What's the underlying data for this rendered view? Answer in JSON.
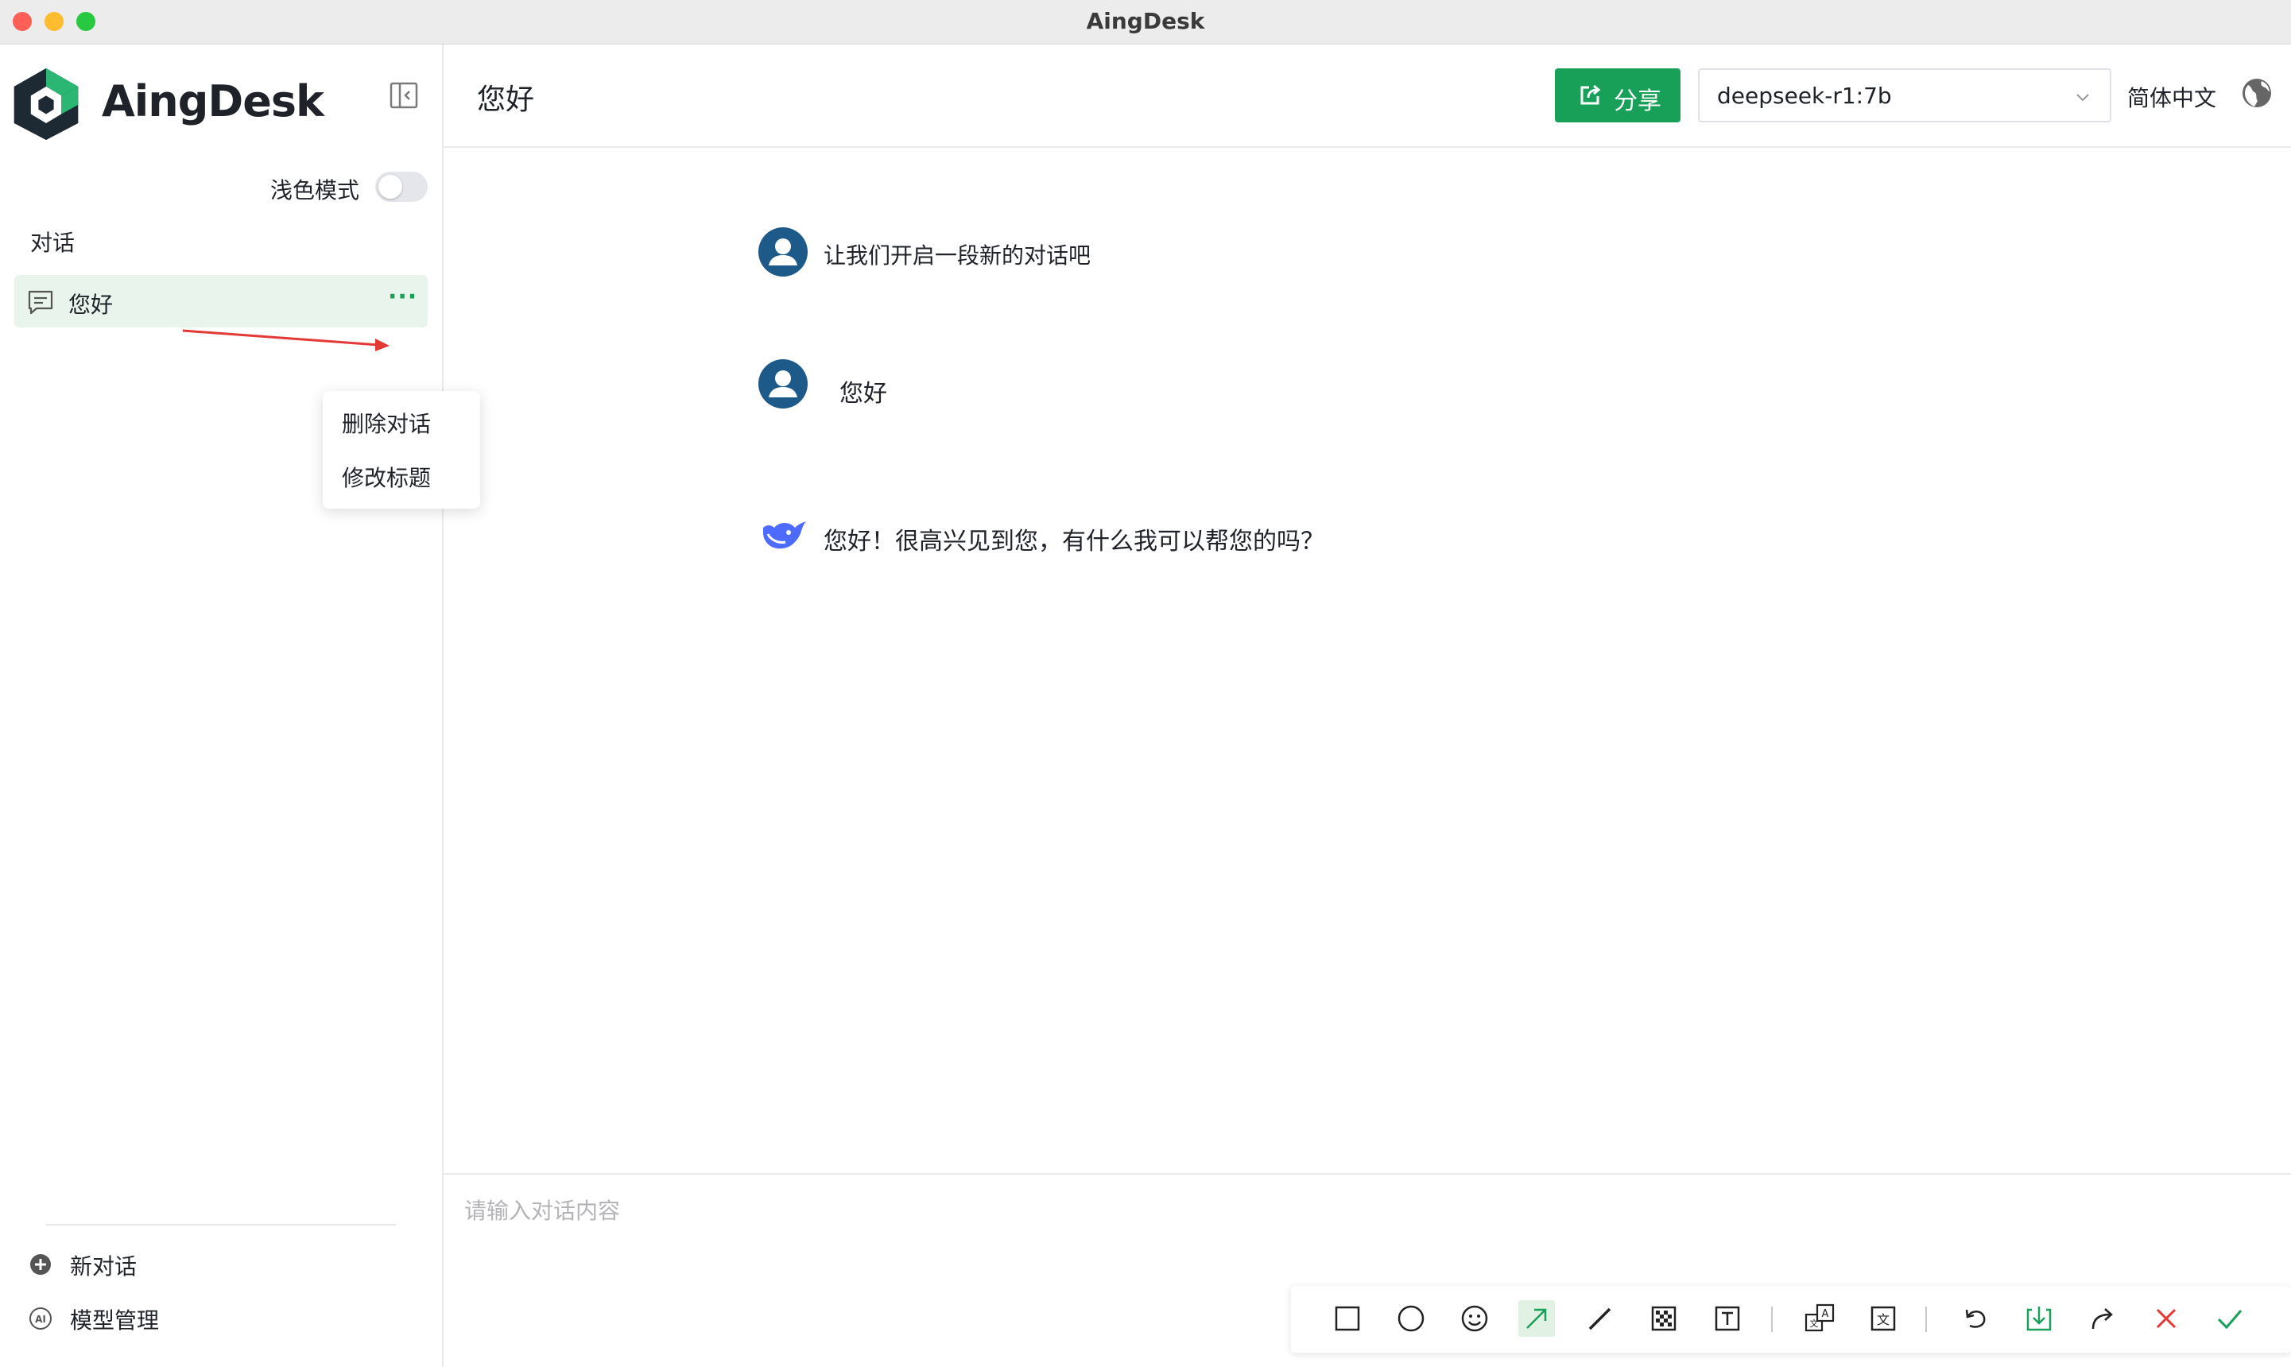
{
  "window": {
    "title": "AingDesk"
  },
  "sidebar": {
    "logo_text": "AingDesk",
    "theme_label": "浅色模式",
    "theme_toggle_on": false,
    "section_label": "对话",
    "conversations": [
      {
        "title": "您好",
        "more": "···",
        "active": true
      }
    ],
    "context_menu": {
      "items": [
        "删除对话",
        "修改标题"
      ]
    },
    "bottom": {
      "new_conversation": "新对话",
      "model_management": "模型管理"
    }
  },
  "header": {
    "title": "您好",
    "share_label": "分享",
    "model_selected": "deepseek-r1:7b",
    "language": "简体中文"
  },
  "messages": [
    {
      "role": "user",
      "text": "让我们开启一段新的对话吧"
    },
    {
      "role": "user",
      "text": "您好"
    },
    {
      "role": "assistant",
      "text": "您好！很高兴见到您，有什么我可以帮您的吗？"
    }
  ],
  "input": {
    "placeholder": "请输入对话内容",
    "value": ""
  },
  "screenshot_toolbar": {
    "tools": [
      "rectangle-icon",
      "ellipse-icon",
      "emoji-icon",
      "arrow-icon",
      "pen-icon",
      "mosaic-icon",
      "text-icon",
      "translate-icon",
      "ocr-icon",
      "undo-icon",
      "save-icon",
      "share-icon",
      "cancel-icon",
      "confirm-icon"
    ],
    "active_tool": "arrow-icon"
  },
  "colors": {
    "accent": "#18a058",
    "active_item_bg": "#e9f5ec",
    "avatar": "#1d5a8a",
    "annotation_arrow": "#e53935"
  }
}
